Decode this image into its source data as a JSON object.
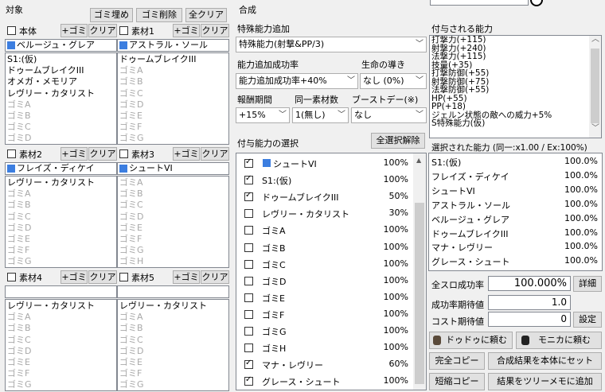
{
  "left": {
    "section_title": "対象",
    "btn_trash_fill": "ゴミ埋め",
    "btn_trash_delete": "ゴミ削除",
    "btn_clear_all": "全クリア",
    "panels": [
      {
        "label": "本体",
        "add": "+ゴミ",
        "clear": "クリア",
        "name": "ベルージュ・グレア",
        "has_icon": true,
        "items": [
          "S1:(仮)",
          "ドゥームブレイクIII",
          "オメガ・メモリア",
          "レヴリー・カタリスト",
          "ゴミA",
          "ゴミB",
          "ゴミC",
          "ゴミD"
        ],
        "dim_from": 4
      },
      {
        "label": "素材1",
        "add": "+ゴミ",
        "clear": "クリア",
        "name": "アストラル・ソール",
        "has_icon": true,
        "items": [
          "ドゥームブレイクIII",
          "ゴミA",
          "ゴミB",
          "ゴミC",
          "ゴミD",
          "ゴミE",
          "ゴミF",
          "ゴミG"
        ],
        "dim_from": 1
      },
      {
        "label": "素材2",
        "add": "+ゴミ",
        "clear": "クリア",
        "name": "フレイズ・ディケイ",
        "has_icon": true,
        "items": [
          "レヴリー・カタリスト",
          "ゴミA",
          "ゴミB",
          "ゴミC",
          "ゴミD",
          "ゴミE",
          "ゴミF",
          "ゴミG"
        ],
        "dim_from": 1
      },
      {
        "label": "素材3",
        "add": "+ゴミ",
        "clear": "クリア",
        "name": "シュートVI",
        "has_icon": true,
        "items": [
          "ゴミA",
          "ゴミB",
          "ゴミC",
          "ゴミD",
          "ゴミE",
          "ゴミF",
          "ゴミG",
          "ゴミH"
        ],
        "dim_from": 0
      },
      {
        "label": "素材4",
        "add": "+ゴミ",
        "clear": "クリア",
        "name": "",
        "has_icon": false,
        "items": [
          "レヴリー・カタリスト",
          "ゴミA",
          "ゴミB",
          "ゴミC",
          "ゴミD",
          "ゴミE",
          "ゴミF",
          "ゴミG"
        ],
        "dim_from": 1
      },
      {
        "label": "素材5",
        "add": "+ゴミ",
        "clear": "クリア",
        "name": "",
        "has_icon": false,
        "items": [
          "レヴリー・カタリスト",
          "ゴミA",
          "ゴミB",
          "ゴミC",
          "ゴミD",
          "ゴミE",
          "ゴミF",
          "ゴミG"
        ],
        "dim_from": 1
      }
    ]
  },
  "mid": {
    "section_title": "合成",
    "special_label": "特殊能力追加",
    "special_value": "特殊能力(射撃&PP/3)",
    "rate_label": "能力追加成功率",
    "rate_value": "能力追加成功率+40%",
    "life_label": "生命の導き",
    "life_value": "なし (0%)",
    "reward_label": "報酬期間",
    "reward_value": "+15%",
    "same_label": "同一素材数",
    "same_value": "1(無し)",
    "boost_label": "ブーストデー(※)",
    "boost_value": "なし",
    "select_label": "付与能力の選択",
    "deselect_btn": "全選択解除",
    "abilities": [
      {
        "name": "シュートVI",
        "pct": "100%",
        "checked": true,
        "icon": true
      },
      {
        "name": "S1:(仮)",
        "pct": "100%",
        "checked": true,
        "icon": false
      },
      {
        "name": "ドゥームブレイクIII",
        "pct": "50%",
        "checked": true,
        "icon": false
      },
      {
        "name": "レヴリー・カタリスト",
        "pct": "30%",
        "checked": false,
        "icon": false
      },
      {
        "name": "ゴミA",
        "pct": "100%",
        "checked": false,
        "icon": false
      },
      {
        "name": "ゴミB",
        "pct": "100%",
        "checked": false,
        "icon": false
      },
      {
        "name": "ゴミC",
        "pct": "100%",
        "checked": false,
        "icon": false
      },
      {
        "name": "ゴミD",
        "pct": "100%",
        "checked": false,
        "icon": false
      },
      {
        "name": "ゴミE",
        "pct": "100%",
        "checked": false,
        "icon": false
      },
      {
        "name": "ゴミF",
        "pct": "100%",
        "checked": false,
        "icon": false
      },
      {
        "name": "ゴミG",
        "pct": "100%",
        "checked": false,
        "icon": false
      },
      {
        "name": "ゴミH",
        "pct": "100%",
        "checked": false,
        "icon": false
      },
      {
        "name": "マナ・レヴリー",
        "pct": "60%",
        "checked": true,
        "icon": false
      },
      {
        "name": "グレース・シュート",
        "pct": "100%",
        "checked": true,
        "icon": false
      }
    ]
  },
  "right": {
    "granted_label": "付与される能力",
    "granted": [
      "打撃力(+115)",
      "射撃力(+240)",
      "法撃力(+115)",
      "技量(+35)",
      "打撃防御(+55)",
      "射撃防御(+75)",
      "法撃防御(+55)",
      "HP(+55)",
      "PP(+18)",
      "ジェルン状態の敵への威力+5%",
      "S特殊能力(仮)"
    ],
    "selected_label": "選択された能力 (同一:x1.00 / Ex:100%)",
    "selected": [
      {
        "name": "S1:(仮)",
        "pct": "100.0%"
      },
      {
        "name": "フレイズ・ディケイ",
        "pct": "100.0%"
      },
      {
        "name": "シュートVI",
        "pct": "100.0%"
      },
      {
        "name": "アストラル・ソール",
        "pct": "100.0%"
      },
      {
        "name": "ベルージュ・グレア",
        "pct": "100.0%"
      },
      {
        "name": "ドゥームブレイクIII",
        "pct": "100.0%"
      },
      {
        "name": "マナ・レヴリー",
        "pct": "100.0%"
      },
      {
        "name": "グレース・シュート",
        "pct": "100.0%"
      }
    ],
    "all_rate_label": "全スロ成功率",
    "all_rate_value": "100.000%",
    "detail_btn": "詳細",
    "expect_label": "成功率期待値",
    "expect_value": "1.0",
    "cost_label": "コスト期待値",
    "cost_value": "0",
    "settings_btn": "設定",
    "dodo_btn": "ドゥドゥに頼む",
    "monica_btn": "モニカに頼む",
    "full_copy_btn": "完全コピー",
    "set_result_btn": "合成結果を本体にセット",
    "short_copy_btn": "短縮コピー",
    "tree_memo_btn": "結果をツリーメモに追加"
  }
}
